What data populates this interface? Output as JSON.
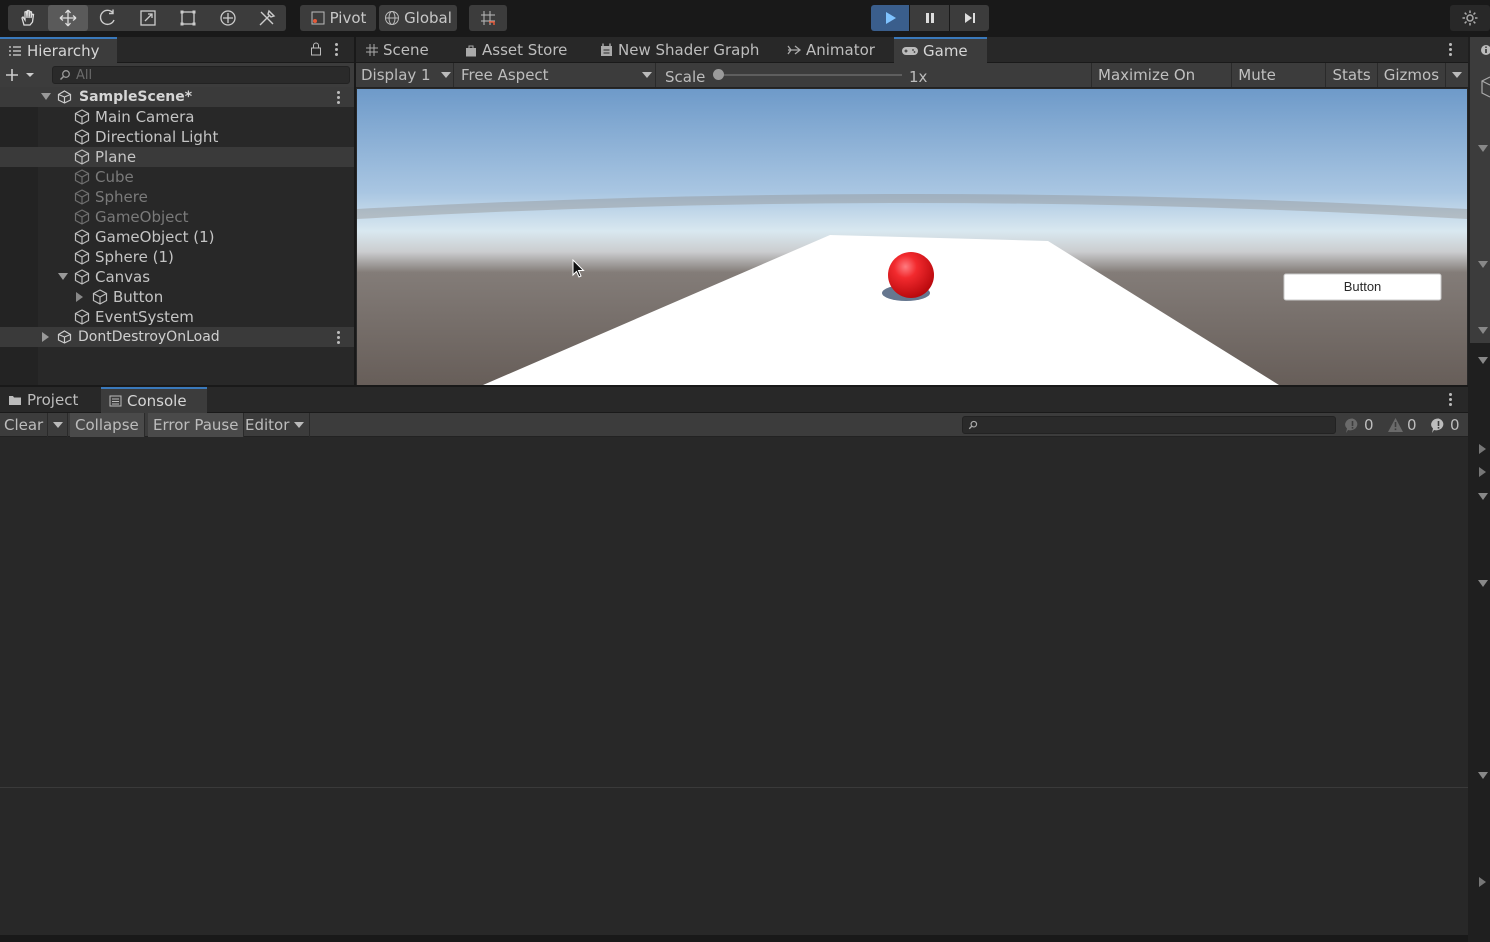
{
  "toolbar": {
    "tools": [
      "hand-tool-icon",
      "move-tool-icon",
      "rotate-tool-icon",
      "scale-tool-icon",
      "rect-tool-icon",
      "transform-tool-icon",
      "custom-tool-icon"
    ],
    "pivot_label": "Pivot",
    "global_label": "Global"
  },
  "hierarchy": {
    "tab_label": "Hierarchy",
    "search_placeholder": "All",
    "scene_name": "SampleScene*",
    "items": [
      {
        "label": "Main Camera",
        "dim": false
      },
      {
        "label": "Directional Light",
        "dim": false
      },
      {
        "label": "Plane",
        "dim": false
      },
      {
        "label": "Cube",
        "dim": true
      },
      {
        "label": "Sphere",
        "dim": true
      },
      {
        "label": "GameObject",
        "dim": true
      },
      {
        "label": "GameObject (1)",
        "dim": false
      },
      {
        "label": "Sphere (1)",
        "dim": false
      },
      {
        "label": "Canvas",
        "dim": false
      },
      {
        "label": "Button",
        "dim": false
      },
      {
        "label": "EventSystem",
        "dim": false
      }
    ],
    "ddol_label": "DontDestroyOnLoad"
  },
  "center_tabs": [
    "Scene",
    "Asset Store",
    "New Shader Graph",
    "Animator",
    "Game"
  ],
  "game": {
    "display": "Display 1",
    "aspect": "Free Aspect",
    "scale_label": "Scale",
    "scale_value": "1x",
    "maximize": "Maximize On Play",
    "mute": "Mute Audio",
    "stats": "Stats",
    "gizmos": "Gizmos",
    "ui_button_label": "Button"
  },
  "bottom_tabs": [
    "Project",
    "Console"
  ],
  "console": {
    "clear": "Clear",
    "collapse": "Collapse",
    "error_pause": "Error Pause",
    "editor": "Editor",
    "info_count": "0",
    "warn_count": "0",
    "error_count": "0"
  },
  "colors": {
    "accent": "#3a79bb",
    "play_active": "#3a5e8c",
    "sphere": "#e8151b"
  }
}
